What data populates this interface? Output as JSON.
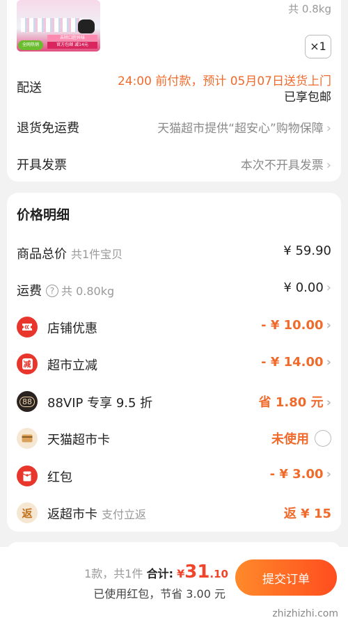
{
  "product": {
    "weight_text": "共 0.8kg",
    "qty_text": "×1",
    "thumb_badge": "全网热销",
    "thumb_ribbon_top": "去除口腔异味",
    "thumb_ribbon_bottom": "官方包邮 减14元"
  },
  "shipping": {
    "label": "配送",
    "line1": "24:00 前付款，预计 05月07日送货上门",
    "line2": "已享包邮"
  },
  "returns": {
    "label": "退货免运费",
    "value": "天猫超市提供“超安心”购物保障"
  },
  "invoice": {
    "label": "开具发票",
    "value": "本次不开具发票"
  },
  "price_detail": {
    "title": "价格明细",
    "rows": [
      {
        "label": "商品总价",
        "sub": "共1件宝贝",
        "value": "¥ 59.90"
      },
      {
        "label": "运费",
        "sub": "共 0.80kg",
        "value": "¥ 0.00"
      },
      {
        "label": "店铺优惠",
        "value": "- ¥ 10.00",
        "icon": "ticket-icon"
      },
      {
        "label": "超市立减",
        "value": "- ¥ 14.00",
        "icon": "discount-icon",
        "icon_text": "减"
      },
      {
        "label": "88VIP 专享 9.5 折",
        "value": "省 1.80 元",
        "icon": "vip-icon",
        "icon_text": "88"
      },
      {
        "label": "天猫超市卡",
        "value": "未使用",
        "icon": "card-icon"
      },
      {
        "label": "红包",
        "value": "- ¥ 3.00",
        "icon": "red-packet-icon"
      },
      {
        "label": "返超市卡",
        "sub": "支付立返",
        "value": "返 ¥ 15",
        "icon": "rebate-icon",
        "icon_text": "返"
      }
    ]
  },
  "bottom_bar": {
    "count_text": "1款，共1件",
    "total_label": "合计:",
    "currency": "¥",
    "total_int": "31",
    "total_dec": ".10",
    "savings_text": "已使用红包，节省 3.00 元",
    "submit_label": "提交订单",
    "watermark": "zhizhizhi.com"
  },
  "colors": {
    "accent": "#f06a2b",
    "total_red": "#f0452b",
    "icon_red": "#e8362c",
    "vip_dark": "#2a2320",
    "card_beige": "#f6e7d2"
  }
}
